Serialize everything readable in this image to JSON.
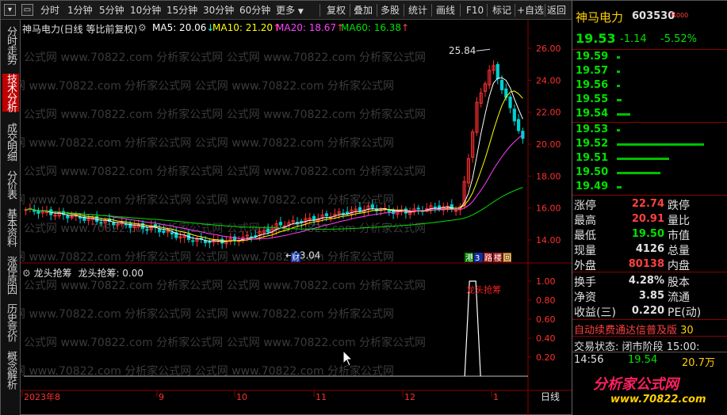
{
  "toolbar": {
    "left_items": [
      "分时",
      "1分钟",
      "5分钟",
      "10分钟",
      "15分钟",
      "30分钟",
      "60分钟",
      "更多"
    ],
    "right_items": [
      "复权",
      "叠加",
      "多股",
      "统计",
      "画线",
      "F10",
      "标记",
      "+自选",
      "返回"
    ]
  },
  "left_tabs": [
    "分时走势",
    "技术分析",
    "成交明细",
    "分价表",
    "基本资料",
    "涨停原因",
    "历史竞价",
    "概念解析"
  ],
  "chart": {
    "title": "神马电力(日线 等比前复权)",
    "ma": [
      {
        "label": "MA5: 20.06",
        "arrow": "↓",
        "color": "#ffffff"
      },
      {
        "label": "MA10: 21.20",
        "arrow": "↑",
        "color": "#ffff00"
      },
      {
        "label": "MA20: 18.67",
        "arrow": "↑",
        "color": "#ff40ff"
      },
      {
        "label": "MA60: 16.38",
        "arrow": "↑",
        "color": "#00e000"
      }
    ],
    "price_axis": [
      "26.00",
      "24.00",
      "22.00",
      "20.00",
      "18.00",
      "16.00",
      "14.00"
    ],
    "high_label": "25.84",
    "low_label": "13.04",
    "fin_mark": "财",
    "marks": [
      "港",
      "3",
      "路",
      "楼",
      "回"
    ],
    "indicator_title": "龙头抢筹",
    "indicator_value": "龙头抢筹: 0.00",
    "indicator_axis": [
      "1.00",
      "0.80",
      "0.60",
      "0.40",
      "0.20"
    ],
    "indicator_label": "龙头抢筹",
    "x_labels": [
      "2023年8",
      "9",
      "10",
      "11",
      "12",
      "1"
    ],
    "period_label": "日线",
    "watermark": "公式网 www.70822.com 分析家公式网"
  },
  "quote": {
    "name": "神马电力",
    "code": "603530",
    "tag": "R",
    "price": "19.53",
    "change": "-1.14",
    "change_pct": "-5.52%",
    "asks": [
      {
        "price": "19.59",
        "bar": 0.03
      },
      {
        "price": "19.57",
        "bar": 0.03
      },
      {
        "price": "19.56",
        "bar": 0.03
      },
      {
        "price": "19.55",
        "bar": 0.05
      },
      {
        "price": "19.54",
        "bar": 0.15
      }
    ],
    "bids": [
      {
        "price": "19.53",
        "bar": 0.03
      },
      {
        "price": "19.52",
        "bar": 1.0
      },
      {
        "price": "19.51",
        "bar": 0.6
      },
      {
        "price": "19.50",
        "bar": 0.5
      },
      {
        "price": "19.49",
        "bar": 0.05
      }
    ],
    "stats": [
      {
        "l1": "涨停",
        "v1": "22.74",
        "c1": "red",
        "l2": "跌停",
        "v2": "",
        "c2": "grn"
      },
      {
        "l1": "最高",
        "v1": "20.91",
        "c1": "red",
        "l2": "量比",
        "v2": "",
        "c2": "wht"
      },
      {
        "l1": "最低",
        "v1": "19.50",
        "c1": "grn",
        "l2": "市值",
        "v2": "",
        "c2": "wht"
      },
      {
        "l1": "现量",
        "v1": "4126",
        "c1": "wht",
        "l2": "总量",
        "v2": "",
        "c2": "wht"
      },
      {
        "l1": "外盘",
        "v1": "80138",
        "c1": "red",
        "l2": "内盘",
        "v2": "",
        "c2": "grn"
      }
    ],
    "fin": [
      {
        "l1": "换手",
        "v1": "4.28%",
        "l2": "股本"
      },
      {
        "l1": "净资",
        "v1": "3.85",
        "l2": "流通"
      },
      {
        "l1": "收益(三)",
        "v1": "0.220",
        "l2": "PE(动)"
      }
    ],
    "promo": "自动续费通达信普及版",
    "promo_num": "30",
    "trade_status_label": "交易状态:",
    "trade_status": "闭市阶段",
    "trade_time": "15:00:",
    "tick": {
      "time": "14:56",
      "price": "19.54",
      "vol": "20.7万"
    },
    "brand": "分析家公式网",
    "brand_url": "www.70822.com"
  }
}
